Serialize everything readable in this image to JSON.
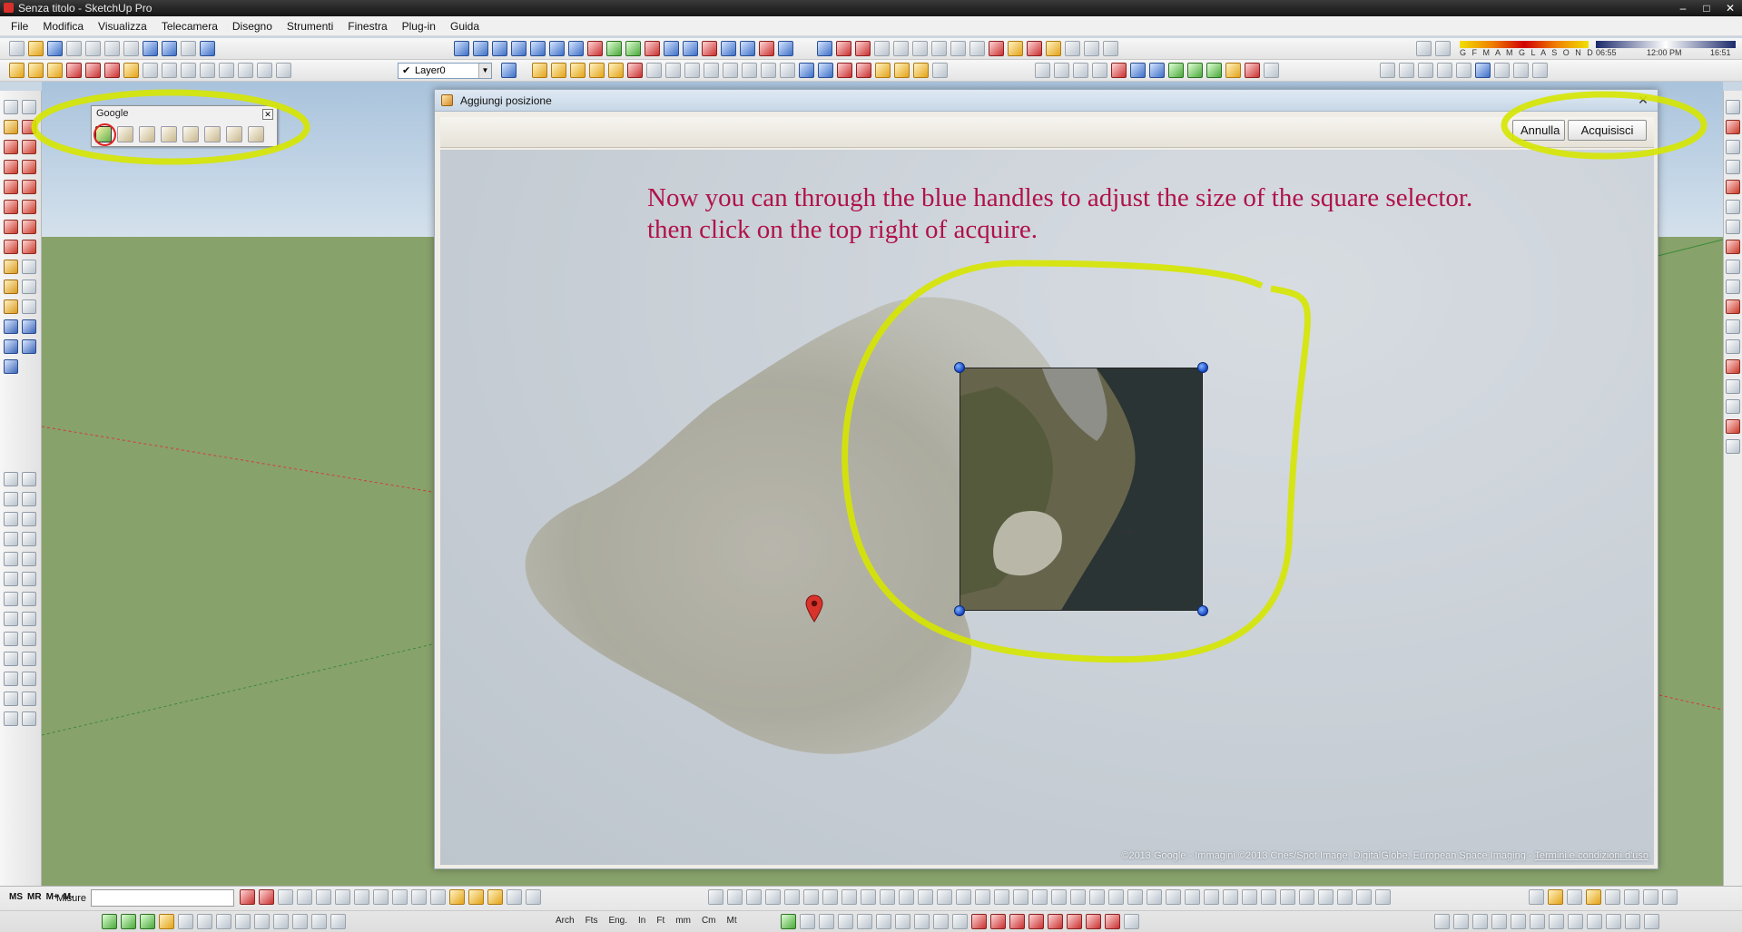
{
  "window": {
    "title": "Senza titolo - SketchUp Pro",
    "controls": [
      "–",
      "□",
      "✕"
    ]
  },
  "menu": {
    "items": [
      "File",
      "Modifica",
      "Visualizza",
      "Telecamera",
      "Disegno",
      "Strumenti",
      "Finestra",
      "Plug-in",
      "Guida"
    ]
  },
  "toolbar": {
    "layer_value": "Layer0",
    "months": "G F M A M G L A S O N D",
    "time_start": "06:55",
    "time_mid": "12:00 PM",
    "time_end": "16:51"
  },
  "google_toolbar": {
    "title": "Google",
    "close_label": "✕",
    "icons": [
      "add-location-icon",
      "toggle-terrain-icon",
      "add-building-icon",
      "photo-textures-icon",
      "preview-google-earth-icon",
      "get-models-icon",
      "share-model-icon",
      "share-component-icon"
    ],
    "active_icon": "add-location-icon"
  },
  "dialog": {
    "title": "Aggiungi posizione",
    "close_label": "✕",
    "cancel_label": "Annulla",
    "acquire_label": "Acquisisci",
    "instruction_line1": "Now you can through the blue handles to adjust the size of the square selector.",
    "instruction_line2": "then click on the top right of acquire.",
    "copyright": "©2013 Google - Immagini ©2013 Cnes/Spot Image, DigitalGlobe, European Space Imaging - ",
    "terms_link": "Termini e condizioni d'uso"
  },
  "status": {
    "ms_labels": [
      "MS",
      "MR",
      "M+",
      "M-"
    ],
    "measure_label": "Misure",
    "measure_value": "",
    "units": [
      "In",
      "Ft",
      "mm",
      "Cm",
      "Mt"
    ],
    "arch_labels": [
      "Arch",
      "Fts",
      "Eng."
    ]
  },
  "colors": {
    "annotation": "#d6e600",
    "instruction_text": "#b0124a",
    "handle": "#1646c2",
    "pin": "#d8342c"
  }
}
